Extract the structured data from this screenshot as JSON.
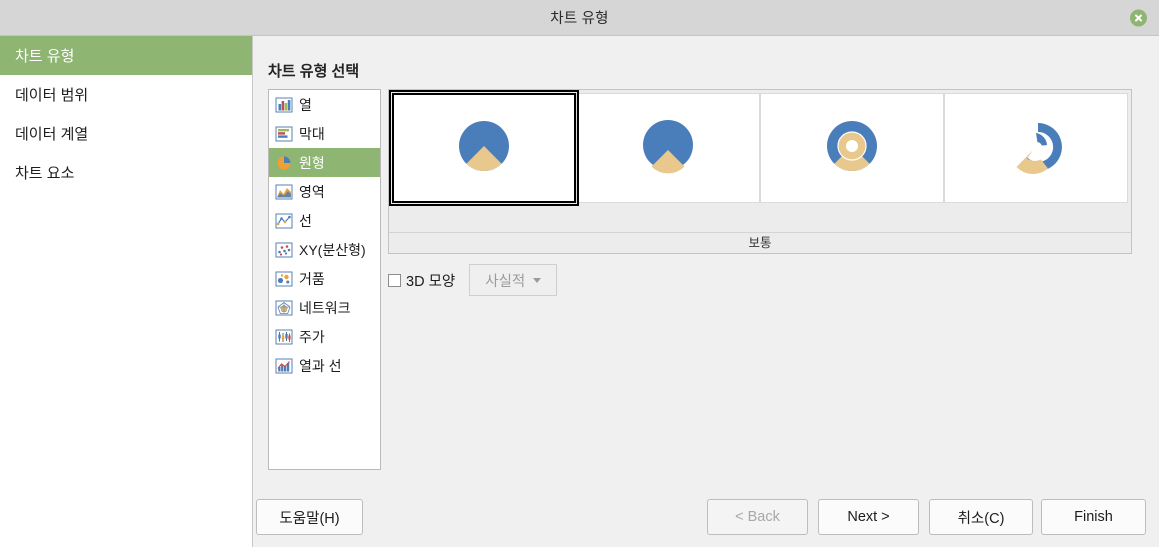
{
  "window": {
    "title": "차트 유형",
    "close_icon": "close-circle-icon"
  },
  "sidebar": {
    "items": [
      {
        "label": "차트 유형",
        "active": true
      },
      {
        "label": "데이터 범위",
        "active": false
      },
      {
        "label": "데이터 계열",
        "active": false
      },
      {
        "label": "차트 요소",
        "active": false
      }
    ]
  },
  "main": {
    "section_title": "차트 유형 선택",
    "chart_types": [
      {
        "label": "열",
        "icon": "column-chart-icon",
        "selected": false
      },
      {
        "label": "막대",
        "icon": "bar-chart-icon",
        "selected": false
      },
      {
        "label": "원형",
        "icon": "pie-chart-icon",
        "selected": true
      },
      {
        "label": "영역",
        "icon": "area-chart-icon",
        "selected": false
      },
      {
        "label": "선",
        "icon": "line-chart-icon",
        "selected": false
      },
      {
        "label": "XY(분산형)",
        "icon": "scatter-chart-icon",
        "selected": false
      },
      {
        "label": "거품",
        "icon": "bubble-chart-icon",
        "selected": false
      },
      {
        "label": "네트워크",
        "icon": "net-chart-icon",
        "selected": false
      },
      {
        "label": "주가",
        "icon": "stock-chart-icon",
        "selected": false
      },
      {
        "label": "열과 선",
        "icon": "column-line-chart-icon",
        "selected": false
      }
    ],
    "variants": [
      {
        "name": "normal-pie-variant",
        "selected": true
      },
      {
        "name": "exploded-pie-variant",
        "selected": false
      },
      {
        "name": "donut-variant",
        "selected": false
      },
      {
        "name": "exploded-donut-variant",
        "selected": false
      }
    ],
    "variant_caption": "보통",
    "three_d": {
      "checkbox_label": "3D 모양",
      "checked": false,
      "style_value": "사실적",
      "style_enabled": false
    }
  },
  "footer": {
    "help": "도움말(H)",
    "back": "< Back",
    "back_enabled": false,
    "next": "Next >",
    "cancel": "취소(C)",
    "finish": "Finish"
  },
  "colors": {
    "accent_green": "#8fb573",
    "pie_blue": "#4a7ebb",
    "pie_tan": "#e8c88c",
    "titlebar": "#d6d6d6",
    "dialog_bg": "#f0f0f0"
  }
}
